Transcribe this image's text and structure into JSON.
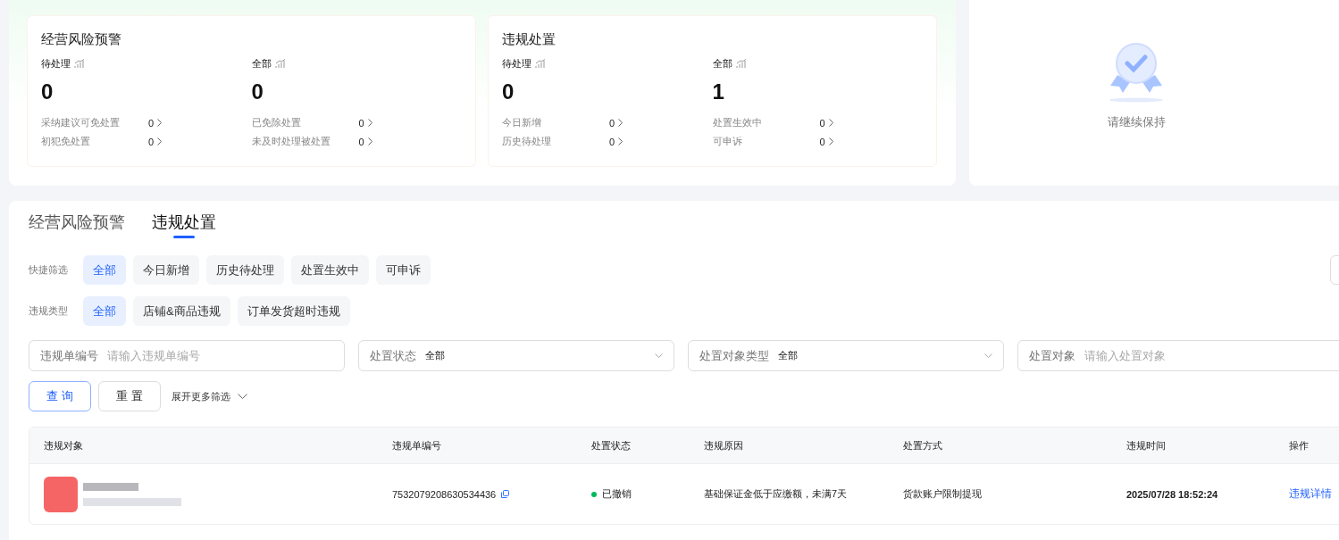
{
  "summary_cards": [
    {
      "title": "经营风险预警",
      "metrics": [
        {
          "label": "待处理",
          "value": "0",
          "details": [
            {
              "label": "采纳建议可免处置",
              "count": "0"
            },
            {
              "label": "初犯免处置",
              "count": "0"
            }
          ]
        },
        {
          "label": "全部",
          "value": "0",
          "details": [
            {
              "label": "已免除处置",
              "count": "0"
            },
            {
              "label": "未及时处理被处置",
              "count": "0"
            }
          ]
        }
      ]
    },
    {
      "title": "违规处置",
      "metrics": [
        {
          "label": "待处理",
          "value": "0",
          "details": [
            {
              "label": "今日新增",
              "count": "0"
            },
            {
              "label": "历史待处理",
              "count": "0"
            }
          ]
        },
        {
          "label": "全部",
          "value": "1",
          "details": [
            {
              "label": "处置生效中",
              "count": "0"
            },
            {
              "label": "可申诉",
              "count": "0"
            }
          ]
        }
      ]
    }
  ],
  "status_panel": {
    "message": "请继续保持"
  },
  "tabs": [
    {
      "label": "经营风险预警",
      "selected": false
    },
    {
      "label": "违规处置",
      "selected": true
    }
  ],
  "filter_groups": [
    {
      "label": "快捷筛选",
      "options": [
        {
          "label": "全部",
          "selected": true
        },
        {
          "label": "今日新增",
          "selected": false
        },
        {
          "label": "历史待处理",
          "selected": false
        },
        {
          "label": "处置生效中",
          "selected": false
        },
        {
          "label": "可申诉",
          "selected": false
        }
      ]
    },
    {
      "label": "违规类型",
      "options": [
        {
          "label": "全部",
          "selected": true
        },
        {
          "label": "店铺&商品违规",
          "selected": false
        },
        {
          "label": "订单发货超时违规",
          "selected": false
        }
      ]
    }
  ],
  "fields": [
    {
      "kind": "text",
      "label": "违规单编号",
      "placeholder": "请输入违规单编号"
    },
    {
      "kind": "select",
      "label": "处置状态",
      "value": "全部"
    },
    {
      "kind": "select",
      "label": "处置对象类型",
      "value": "全部"
    },
    {
      "kind": "text",
      "label": "处置对象",
      "placeholder": "请输入处置对象"
    }
  ],
  "buttons": [
    {
      "kind": "primary",
      "label": "查 询"
    },
    {
      "kind": "default",
      "label": "重 置"
    }
  ],
  "expand_link": "展开更多筛选",
  "table": {
    "columns": [
      "违规对象",
      "违规单编号",
      "处置状态",
      "违规原因",
      "处置方式",
      "违规时间",
      "操作"
    ],
    "rows": [
      {
        "order_no": "7532079208630534436",
        "status": "已撤销",
        "color": "#00b85c",
        "reason": "基础保证金低于应缴额，未满7天",
        "measure": "货款账户限制提现",
        "time": "2025/07/28 18:52:24",
        "action": "违规详情"
      }
    ]
  }
}
